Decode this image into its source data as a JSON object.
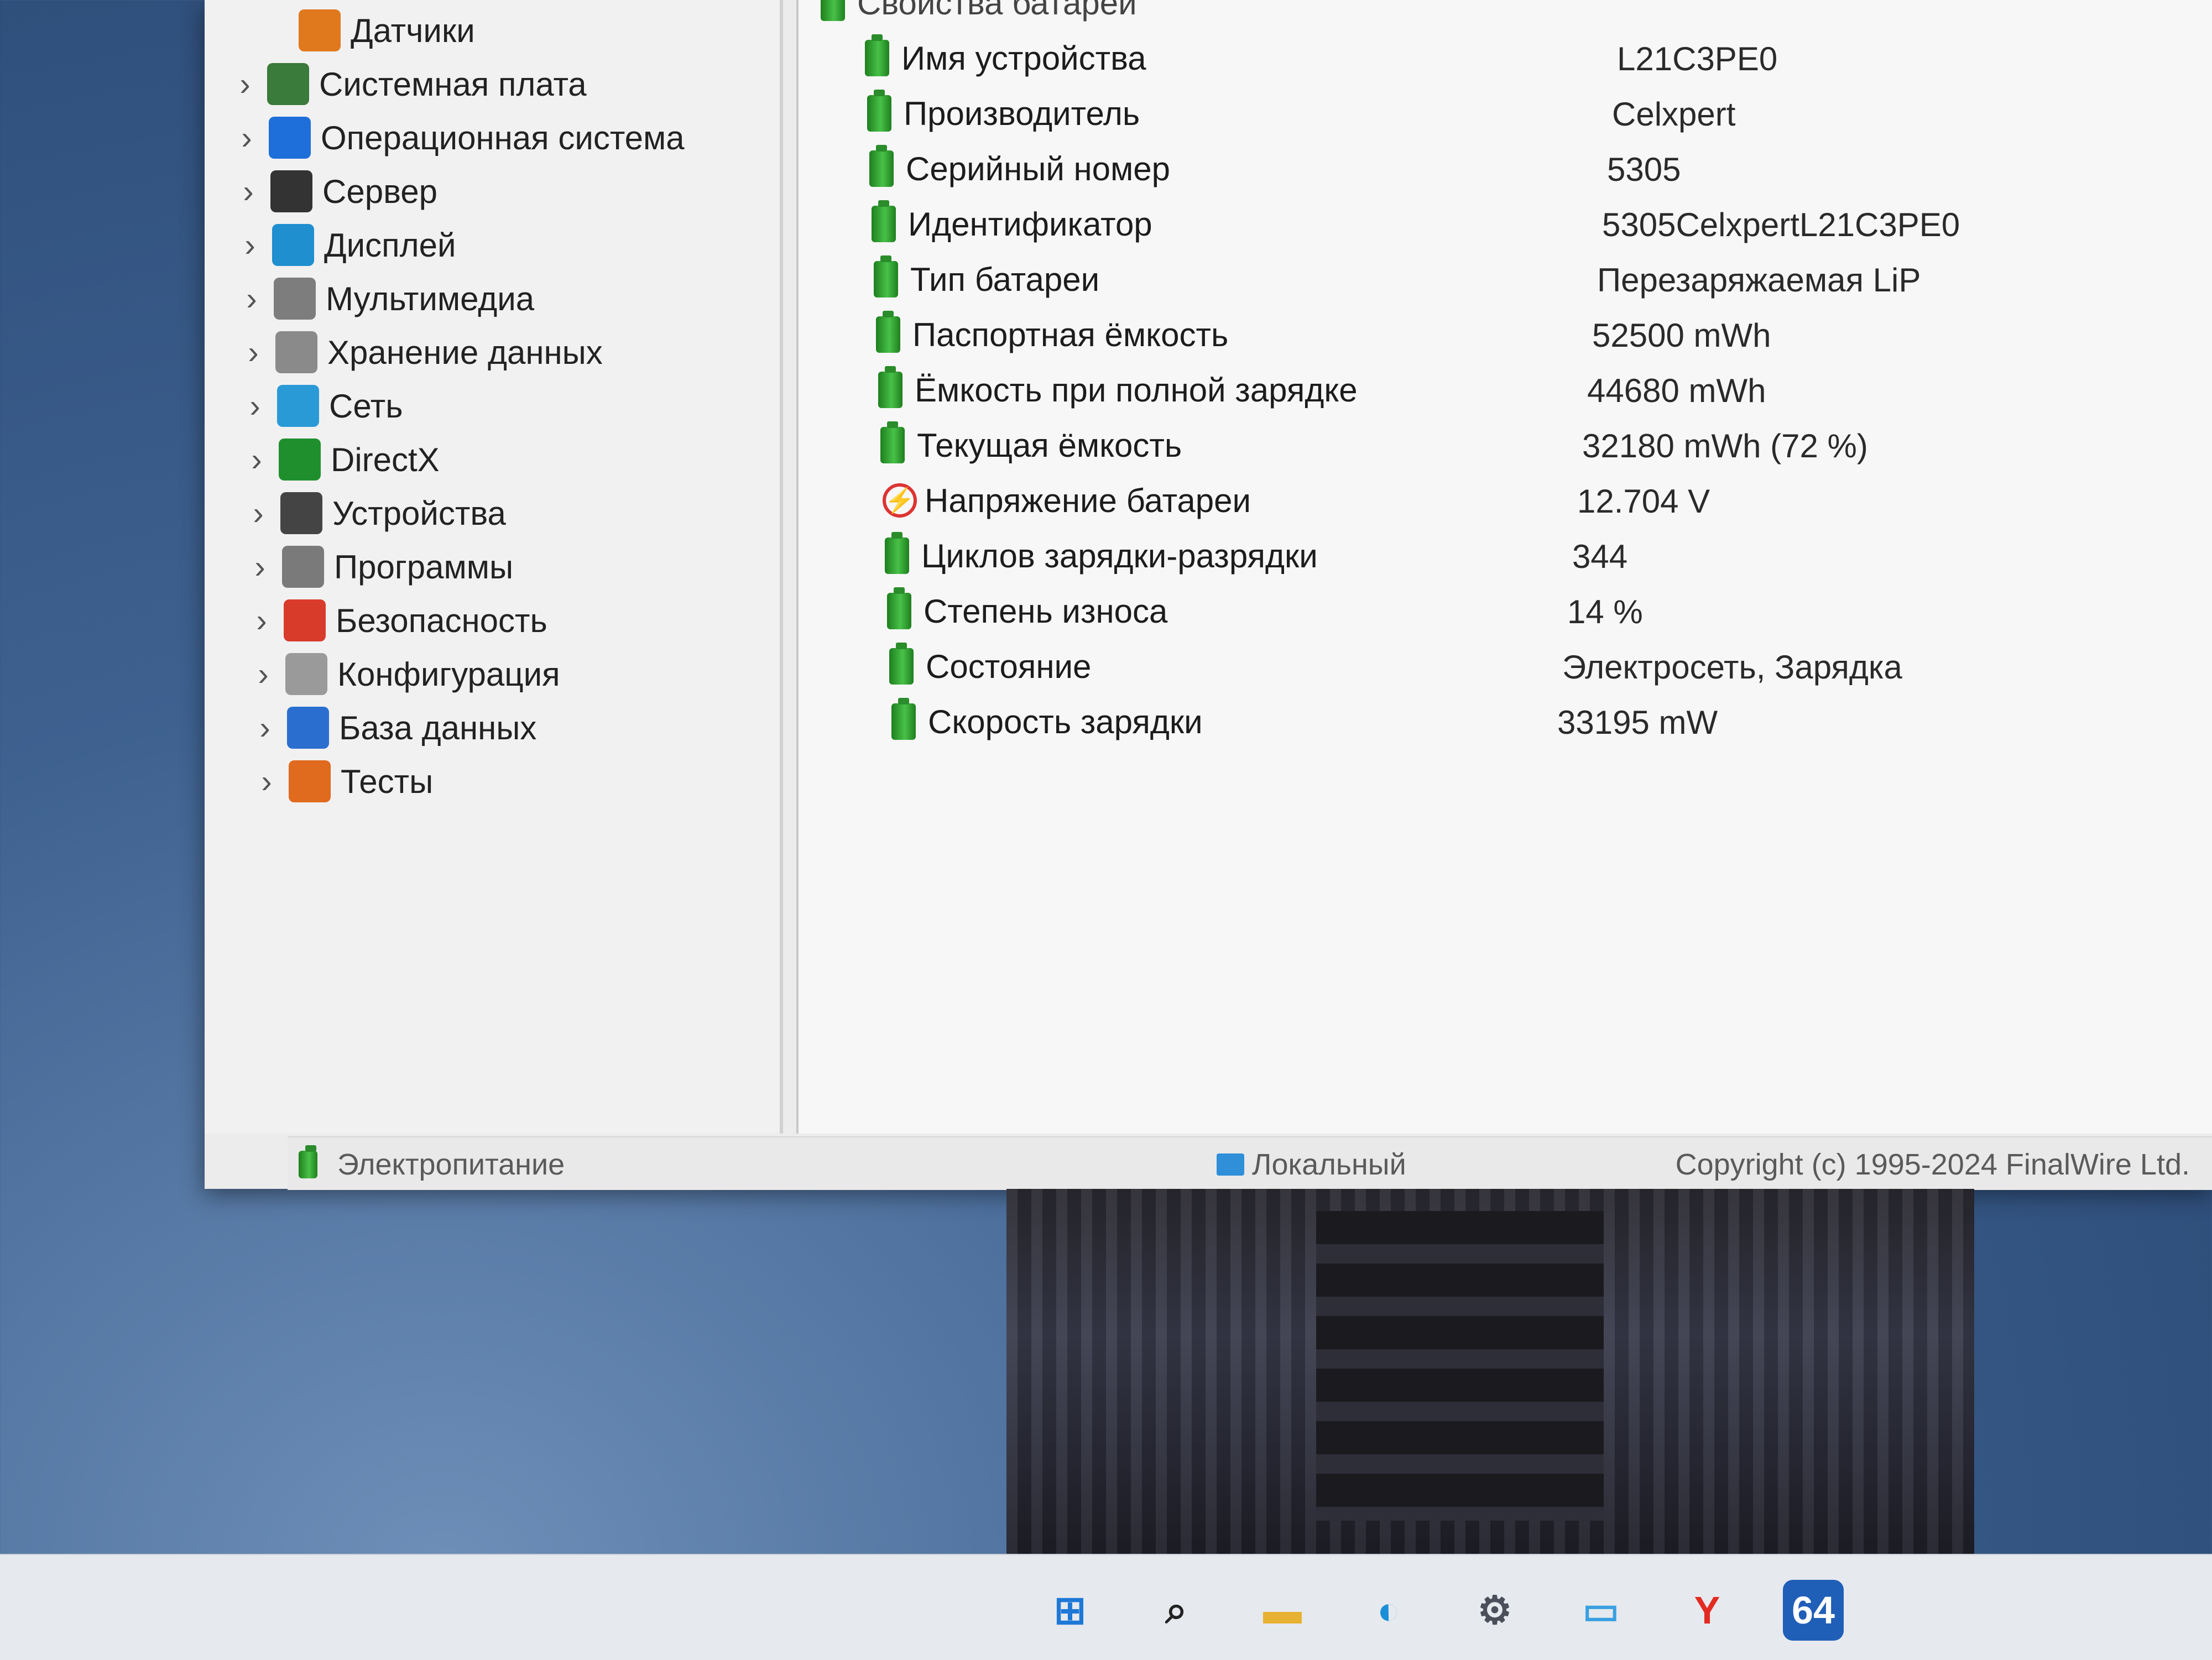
{
  "tree": {
    "items": [
      {
        "label": "Датчики",
        "icon": "sensors-icon",
        "color": "#e0781e",
        "expandable": false
      },
      {
        "label": "Системная плата",
        "icon": "motherboard-icon",
        "color": "#3a7a3a",
        "expandable": true
      },
      {
        "label": "Операционная система",
        "icon": "windows-icon",
        "color": "#1e6fd9",
        "expandable": true
      },
      {
        "label": "Сервер",
        "icon": "server-icon",
        "color": "#333333",
        "expandable": true
      },
      {
        "label": "Дисплей",
        "icon": "display-icon",
        "color": "#1f8fd0",
        "expandable": true
      },
      {
        "label": "Мультимедиа",
        "icon": "multimedia-icon",
        "color": "#7d7d7d",
        "expandable": true
      },
      {
        "label": "Хранение данных",
        "icon": "storage-icon",
        "color": "#8a8a8a",
        "expandable": true
      },
      {
        "label": "Сеть",
        "icon": "network-icon",
        "color": "#2a9ad6",
        "expandable": true
      },
      {
        "label": "DirectX",
        "icon": "directx-icon",
        "color": "#1f8f2e",
        "expandable": true
      },
      {
        "label": "Устройства",
        "icon": "devices-icon",
        "color": "#444444",
        "expandable": true
      },
      {
        "label": "Программы",
        "icon": "programs-icon",
        "color": "#7a7a7a",
        "expandable": true
      },
      {
        "label": "Безопасность",
        "icon": "security-shield-icon",
        "color": "#d93b2b",
        "expandable": true
      },
      {
        "label": "Конфигурация",
        "icon": "configuration-icon",
        "color": "#9a9a9a",
        "expandable": true
      },
      {
        "label": "База данных",
        "icon": "database-icon",
        "color": "#2a6fd0",
        "expandable": true
      },
      {
        "label": "Тесты",
        "icon": "tests-icon",
        "color": "#e06a1e",
        "expandable": true
      }
    ]
  },
  "details": {
    "header": "Свойства батареи",
    "rows": [
      {
        "label": "Имя устройства",
        "value": "L21C3PE0",
        "icon": "battery-icon"
      },
      {
        "label": "Производитель",
        "value": "Celxpert",
        "icon": "battery-icon"
      },
      {
        "label": "Серийный номер",
        "value": "5305",
        "icon": "battery-icon"
      },
      {
        "label": "Идентификатор",
        "value": "5305CelxpertL21C3PE0",
        "icon": "battery-icon"
      },
      {
        "label": "Тип батареи",
        "value": "Перезаряжаемая LiP",
        "icon": "battery-icon"
      },
      {
        "label": "Паспортная ёмкость",
        "value": "52500 mWh",
        "icon": "battery-icon"
      },
      {
        "label": "Ёмкость при полной зарядке",
        "value": "44680 mWh",
        "icon": "battery-icon"
      },
      {
        "label": "Текущая ёмкость",
        "value": "32180 mWh  (72 %)",
        "icon": "battery-icon"
      },
      {
        "label": "Напряжение батареи",
        "value": "12.704 V",
        "icon": "voltage-icon"
      },
      {
        "label": "Циклов зарядки-разрядки",
        "value": "344",
        "icon": "battery-icon"
      },
      {
        "label": "Степень износа",
        "value": "14 %",
        "icon": "battery-icon"
      },
      {
        "label": "Состояние",
        "value": "Электросеть, Зарядка",
        "icon": "battery-icon"
      },
      {
        "label": "Скорость зарядки",
        "value": "33195 mW",
        "icon": "battery-icon"
      }
    ]
  },
  "status": {
    "section": "Электропитание",
    "mode": "Локальный",
    "copyright": "Copyright (c) 1995-2024 FinalWire Ltd."
  },
  "taskbar": {
    "items": [
      {
        "icon": "windows-start-icon",
        "glyph": "⊞",
        "color": "#1e78d6"
      },
      {
        "icon": "search-icon",
        "glyph": "⌕",
        "color": "#222222"
      },
      {
        "icon": "file-explorer-icon",
        "glyph": "▬",
        "color": "#e7b232"
      },
      {
        "icon": "edge-browser-icon",
        "glyph": "◐",
        "color": "#1a8fd8"
      },
      {
        "icon": "settings-gear-icon",
        "glyph": "⚙",
        "color": "#4a4f5a"
      },
      {
        "icon": "monitor-app-icon",
        "glyph": "▭",
        "color": "#3aa0e0"
      },
      {
        "icon": "yandex-browser-icon",
        "glyph": "Y",
        "color": "#e22b22"
      },
      {
        "icon": "aida64-icon",
        "glyph": "64",
        "color": "#1f5fb8"
      }
    ]
  }
}
